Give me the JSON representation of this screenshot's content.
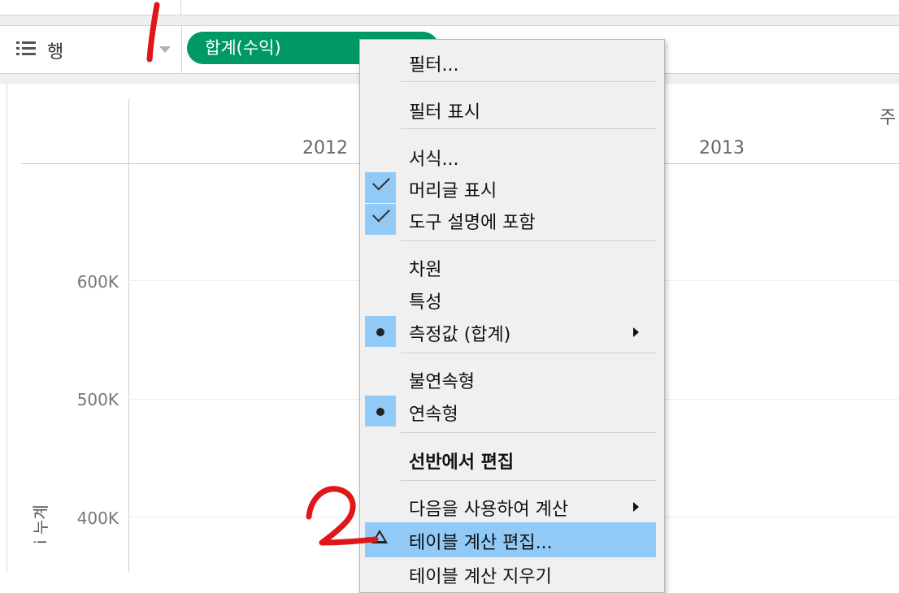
{
  "shelf": {
    "label": "행",
    "pill": "합계(수익)"
  },
  "chart": {
    "years": [
      "2012",
      "2013"
    ],
    "y_ticks": [
      "600K",
      "500K",
      "400K"
    ],
    "column_header_partial": "주",
    "y_axis_title_partial": "i 누계"
  },
  "context_menu": {
    "items": [
      {
        "label": "필터..."
      },
      {
        "label": "필터 표시"
      },
      {
        "label": "서식..."
      },
      {
        "label": "머리글 표시",
        "mark": "check"
      },
      {
        "label": "도구 설명에 포함",
        "mark": "check"
      },
      {
        "label": "차원"
      },
      {
        "label": "특성"
      },
      {
        "label": "측정값 (합계)",
        "mark": "dot",
        "submenu": true
      },
      {
        "label": "불연속형"
      },
      {
        "label": "연속형",
        "mark": "dot"
      },
      {
        "label": "선반에서 편집"
      },
      {
        "label": "다음을 사용하여 계산",
        "submenu": true
      },
      {
        "label": "테이블 계산 편집...",
        "highlighted": true,
        "icon": "delta-icon"
      },
      {
        "label": "테이블 계산 지우기"
      }
    ]
  },
  "annotations": {
    "color": "#e0161b",
    "marks": [
      "1",
      "2"
    ]
  }
}
